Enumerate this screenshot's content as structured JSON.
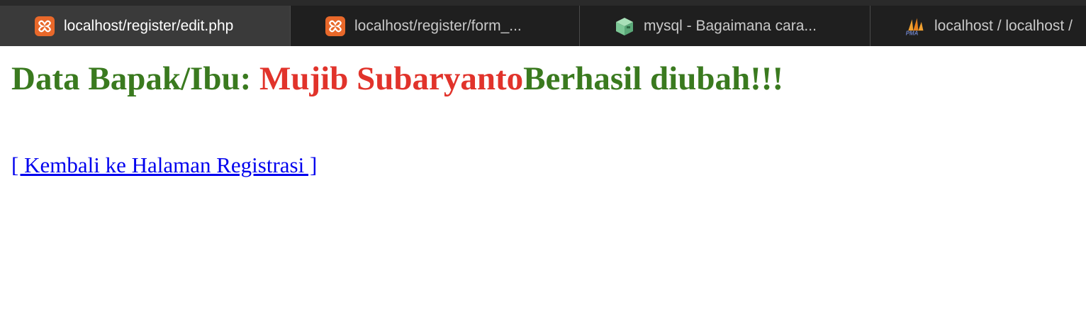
{
  "tabs": [
    {
      "title": "localhost/register/edit.php",
      "icon": "xampp-icon",
      "active": true
    },
    {
      "title": "localhost/register/form_...",
      "icon": "xampp-icon",
      "active": false
    },
    {
      "title": "mysql - Bagaimana cara...",
      "icon": "box-icon",
      "active": false
    },
    {
      "title": "localhost / localhost /",
      "icon": "phpmyadmin-icon",
      "active": false
    }
  ],
  "message": {
    "prefix": "Data Bapak/Ibu: ",
    "name": "Mujib Subaryanto",
    "suffix": "Berhasil diubah!!!"
  },
  "back_link": "[ Kembali ke Halaman Registrasi ]",
  "colors": {
    "success": "#3a7a1f",
    "highlight": "#e1332b",
    "link": "#0000ee"
  }
}
